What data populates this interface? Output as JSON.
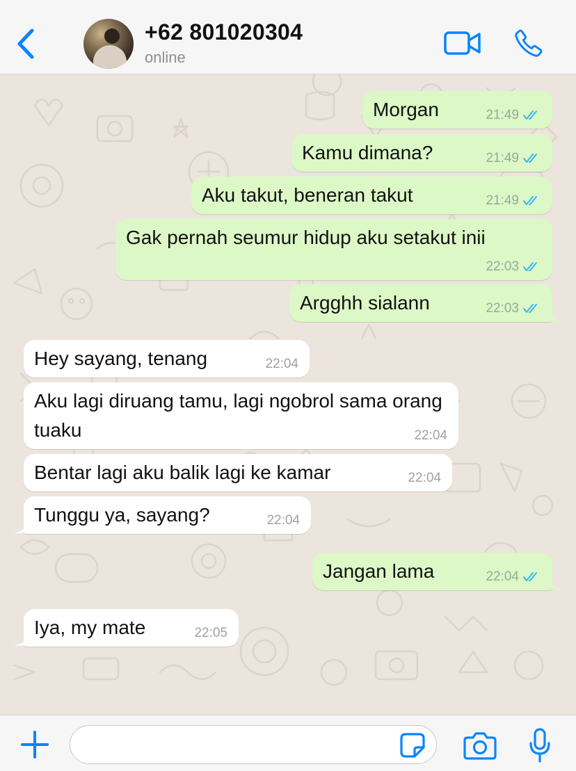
{
  "header": {
    "back_icon": "chevron-left-icon",
    "contact_name": "+62 801020304",
    "status": "online",
    "video_icon": "video-camera-icon",
    "call_icon": "phone-icon"
  },
  "colors": {
    "accent": "#0a84ff",
    "outgoing_bubble": "#dcf8c6",
    "incoming_bubble": "#ffffff",
    "read_ticks": "#34b7f1",
    "chat_background": "#ece5dd"
  },
  "messages": [
    {
      "direction": "outgoing",
      "text": "Morgan",
      "time": "21:49",
      "status": "read"
    },
    {
      "direction": "outgoing",
      "text": "Kamu dimana?",
      "time": "21:49",
      "status": "read"
    },
    {
      "direction": "outgoing",
      "text": "Aku takut, beneran takut",
      "time": "21:49",
      "status": "read"
    },
    {
      "direction": "outgoing",
      "text": "Gak pernah seumur hidup aku setakut inii",
      "time": "22:03",
      "status": "read"
    },
    {
      "direction": "outgoing",
      "text": "Argghh sialann",
      "time": "22:03",
      "status": "read"
    },
    {
      "direction": "incoming",
      "text": "Hey sayang, tenang",
      "time": "22:04"
    },
    {
      "direction": "incoming",
      "text": "Aku lagi diruang tamu, lagi ngobrol sama orang tuaku",
      "time": "22:04"
    },
    {
      "direction": "incoming",
      "text": "Bentar lagi aku balik lagi ke kamar",
      "time": "22:04"
    },
    {
      "direction": "incoming",
      "text": "Tunggu ya, sayang?",
      "time": "22:04"
    },
    {
      "direction": "outgoing",
      "text": "Jangan lama",
      "time": "22:04",
      "status": "read"
    },
    {
      "direction": "incoming",
      "text": "Iya, my mate",
      "time": "22:05"
    }
  ],
  "input_bar": {
    "plus_icon": "plus-icon",
    "message_placeholder": "",
    "sticker_icon": "sticker-icon",
    "camera_icon": "camera-icon",
    "mic_icon": "microphone-icon"
  }
}
